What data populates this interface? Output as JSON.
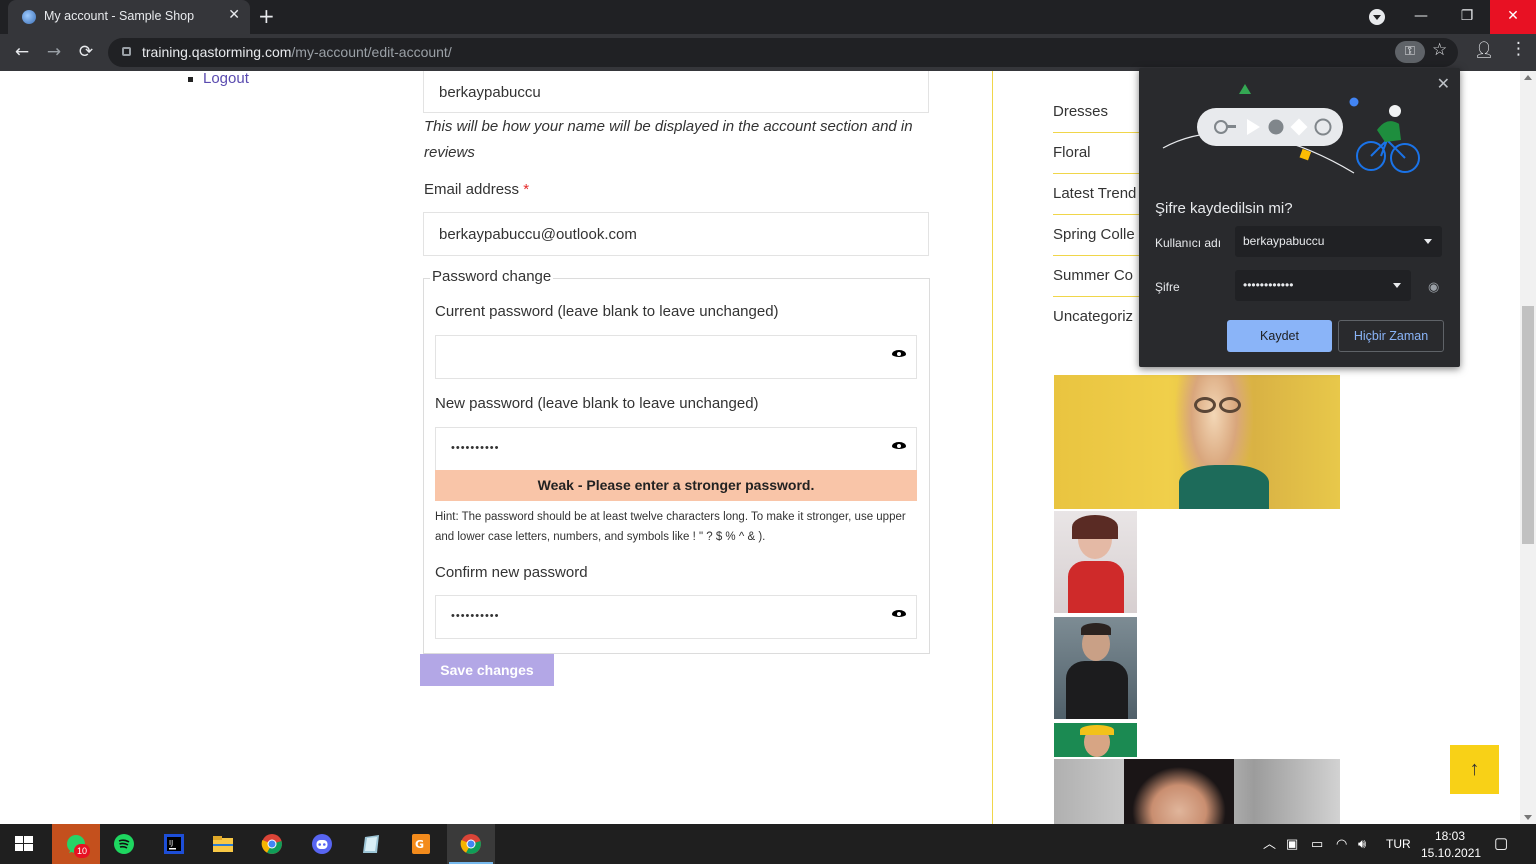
{
  "browser": {
    "tab_title": "My account - Sample Shop",
    "tab_close": "✕",
    "new_tab": "+",
    "url_domain": "training.qastorming.com",
    "url_path": "/my-account/edit-account/",
    "window": {
      "minimize": "—",
      "restore": "❐",
      "close": "✕"
    }
  },
  "account_nav": {
    "logout": "Logout"
  },
  "form": {
    "display_name_value": "berkaypabuccu",
    "display_name_hint": "This will be how your name will be displayed in the account section and in reviews",
    "email_label": "Email address",
    "required_mark": "*",
    "email_value": "berkaypabuccu@outlook.com",
    "password_legend": "Password change",
    "current_password_label": "Current password (leave blank to leave unchanged)",
    "current_password_value": "",
    "new_password_label": "New password (leave blank to leave unchanged)",
    "new_password_masked": "••••••••••",
    "strength_message": "Weak - Please enter a stronger password.",
    "strength_hint": "Hint: The password should be at least twelve characters long. To make it stronger, use upper and lower case letters, numbers, and symbols like ! \" ? $ % ^ & ).",
    "confirm_password_label": "Confirm new password",
    "confirm_password_masked": "••••••••••",
    "save_button": "Save changes"
  },
  "sidebar": {
    "categories": [
      "Dresses",
      "Floral",
      "Latest Trend",
      "Spring Colle",
      "Summer Co",
      "Uncategoriz"
    ]
  },
  "save_password_popup": {
    "title": "Şifre kaydedilsin mi?",
    "username_label": "Kullanıcı adı",
    "username_value": "berkaypabuccu",
    "password_label": "Şifre",
    "password_value": "••••••••••••",
    "save_button": "Kaydet",
    "never_button": "Hiçbir Zaman",
    "close": "✕"
  },
  "taskbar": {
    "whatsapp_badge": "10",
    "language": "TUR",
    "time": "18:03",
    "date": "15.10.2021"
  },
  "colors": {
    "accent": "#5a4bb0",
    "category_rule": "#f0d64a",
    "weak_bg": "#f9c5a8",
    "save_btn": "#b3a7e6",
    "popup_bg": "#292a2d",
    "popup_accent": "#8ab4f8"
  }
}
